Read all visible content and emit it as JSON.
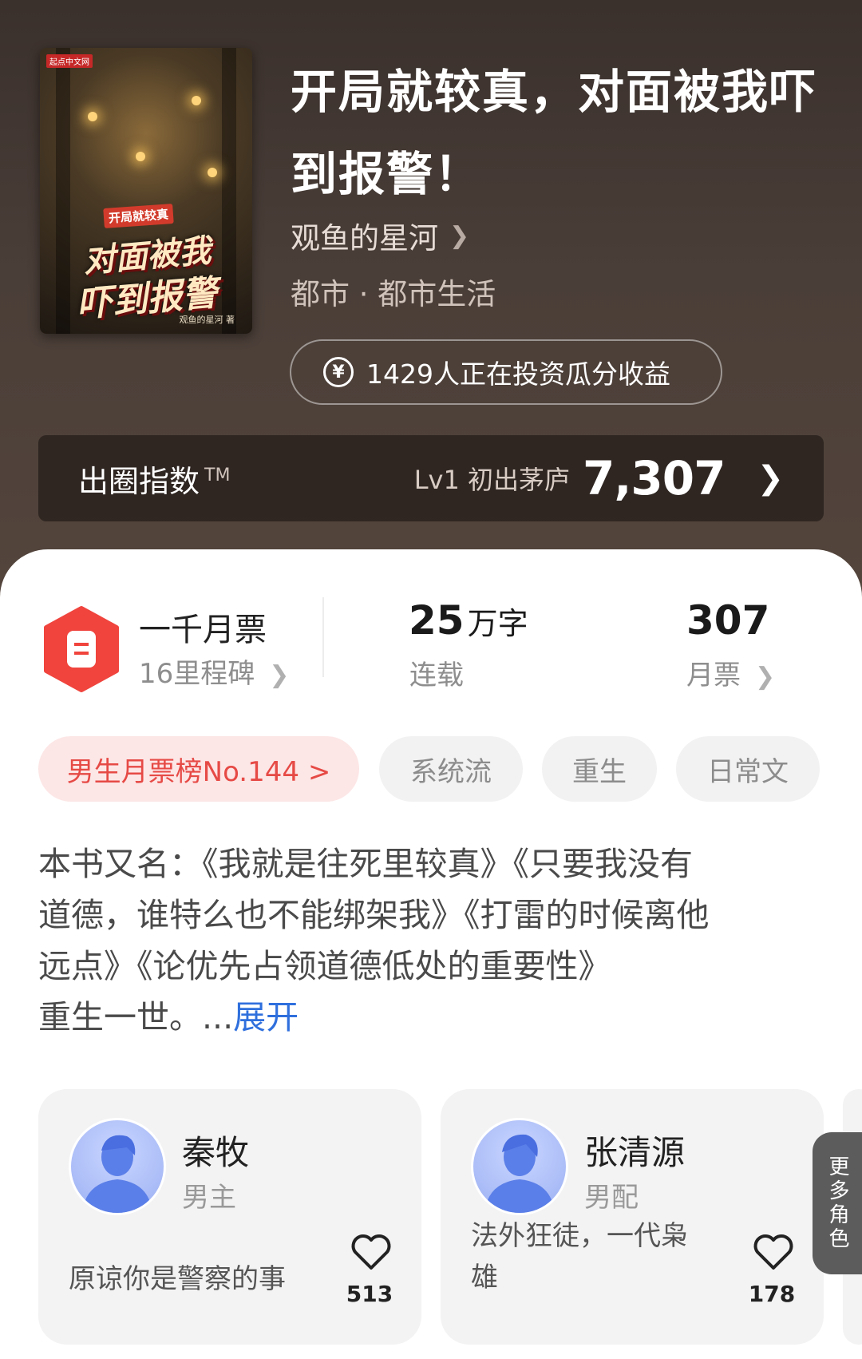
{
  "book": {
    "cover_publisher": "起点中文网",
    "cover_badge": "开局就较真",
    "cover_title_line1": "对面被我",
    "cover_title_line2": "吓到报警",
    "cover_author": "观鱼的星河 著",
    "title": "开局就较真，对面被我吓到报警！",
    "author": "观鱼的星河",
    "genre": "都市 · 都市生活",
    "invest_text": "1429人正在投资瓜分收益",
    "invest_icon": "yen-circle-icon"
  },
  "index_bar": {
    "label": "出圈指数",
    "tm": "TM",
    "level": "Lv1 初出茅庐",
    "value": "7,307"
  },
  "stats": {
    "ticket_title": "一千月票",
    "ticket_sub": "16里程碑",
    "words_num": "25",
    "words_unit": "万字",
    "words_sub": "连载",
    "monthly_num": "307",
    "monthly_sub": "月票"
  },
  "tags": {
    "rank": "男生月票榜No.144 >",
    "t1": "系统流",
    "t2": "重生",
    "t3": "日常文"
  },
  "description": {
    "line1": "本书又名：《我就是往死里较真》《只要我没有",
    "line2": "道德，谁特么也不能绑架我》《打雷的时候离他",
    "line3": "远点》《论优先占领道德低处的重要性》",
    "line4": "重生一世。...",
    "expand": "展开"
  },
  "roles": [
    {
      "name": "秦牧",
      "type": "男主",
      "desc": "原谅你是警察的事",
      "likes": "513"
    },
    {
      "name": "张清源",
      "type": "男配",
      "desc": "法外狂徒，一代枭雄",
      "likes": "178"
    }
  ],
  "more_roles": "更多角色",
  "colors": {
    "accent_red": "#e64a45",
    "link_blue": "#2f6fdd",
    "header_bg": "#4a3e38"
  }
}
